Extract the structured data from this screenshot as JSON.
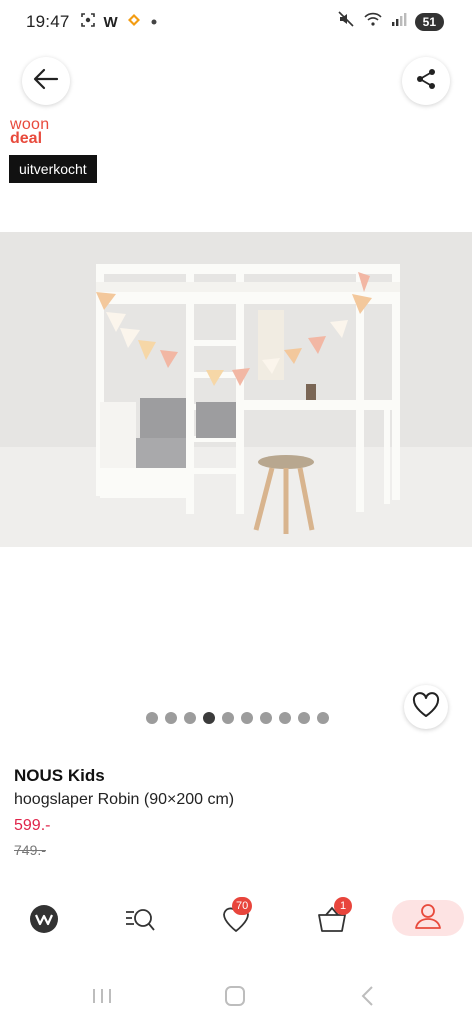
{
  "status_bar": {
    "time": "19:47",
    "left_icons": [
      "screenshot-icon",
      "w-app-icon",
      "vinted-icon",
      "dot-icon"
    ],
    "w_label": "W",
    "right_icons": [
      "mute-icon",
      "wifi-icon",
      "signal-icon"
    ],
    "battery": "51"
  },
  "header": {
    "back_icon": "arrow-left-icon",
    "share_icon": "share-icon"
  },
  "brand_logo": {
    "line1": "woon",
    "line2": "deal"
  },
  "badge": {
    "label": "uitverkocht"
  },
  "gallery": {
    "total_slides": 10,
    "active_index": 3,
    "wishlist_icon": "heart-icon"
  },
  "product": {
    "brand": "NOUS Kids",
    "title": "hoogslaper Robin (90×200 cm)",
    "price": "599.-",
    "old_price": "749.-"
  },
  "bottom_nav": {
    "items": [
      {
        "name": "home",
        "icon": "wehkamp-logo-icon"
      },
      {
        "name": "search",
        "icon": "search-list-icon"
      },
      {
        "name": "wishlist",
        "icon": "heart-icon",
        "badge": "70"
      },
      {
        "name": "cart",
        "icon": "basket-icon",
        "badge": "1"
      },
      {
        "name": "account",
        "icon": "user-icon"
      }
    ]
  },
  "colors": {
    "accent": "#e84a3c",
    "price": "#e0244a",
    "account_bg": "#fde3e3"
  }
}
